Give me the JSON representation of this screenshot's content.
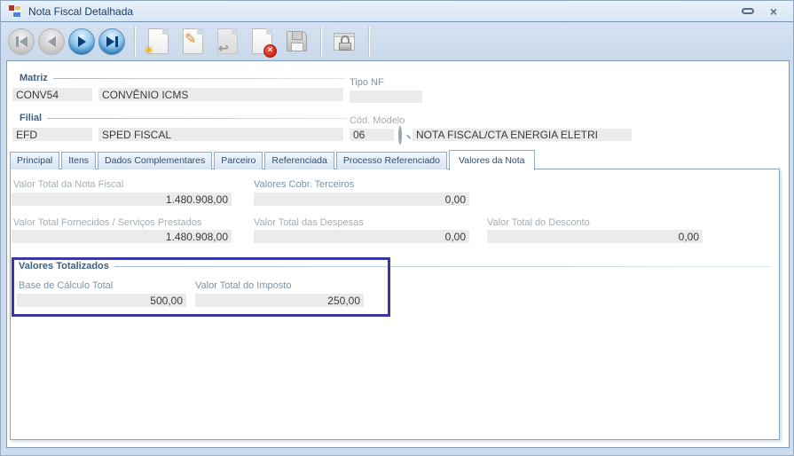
{
  "window": {
    "title": "Nota Fiscal Detalhada",
    "close_glyph": "×"
  },
  "toolbar": {
    "buttons": [
      {
        "icon": "first-record-icon",
        "enabled": false
      },
      {
        "icon": "previous-record-icon",
        "enabled": false
      },
      {
        "icon": "next-record-icon",
        "enabled": true
      },
      {
        "icon": "last-record-icon",
        "enabled": true
      },
      {
        "icon": "new-record-icon",
        "enabled": true,
        "glyph": "☀"
      },
      {
        "icon": "edit-record-icon",
        "enabled": true,
        "glyph": "✎"
      },
      {
        "icon": "undo-icon",
        "enabled": false,
        "glyph": "↩"
      },
      {
        "icon": "delete-record-icon",
        "enabled": true,
        "glyph": "×"
      },
      {
        "icon": "save-icon",
        "enabled": false
      },
      {
        "icon": "security-lock-icon",
        "enabled": true
      }
    ]
  },
  "header": {
    "matriz": {
      "label": "Matriz",
      "code": "CONV54",
      "name": "CONVÊNIO ICMS"
    },
    "filial": {
      "label": "Filial",
      "code": "EFD",
      "name": "SPED FISCAL"
    },
    "tipo_nf": {
      "label": "Tipo NF",
      "value": ""
    },
    "cod_modelo": {
      "label": "Cód. Modelo",
      "code": "06",
      "description": "NOTA FISCAL/CTA ENERGIA ELETRI"
    }
  },
  "tabs": {
    "active": "Valores da Nota",
    "items": [
      {
        "label": "Principal"
      },
      {
        "label": "Itens"
      },
      {
        "label": "Dados Complementares"
      },
      {
        "label": "Parceiro"
      },
      {
        "label": "Referenciada"
      },
      {
        "label": "Processo Referenciado"
      },
      {
        "label": "Valores da Nota"
      }
    ]
  },
  "fields": {
    "valor_total_nota": {
      "label": "Valor Total da Nota Fiscal",
      "value": "1.480.908,00"
    },
    "valores_cobr_terceiros": {
      "label": "Valores Cobr. Terceiros",
      "value": "0,00"
    },
    "valor_total_fornecidos": {
      "label": "Valor Total Fornecidos / Serviços Prestados",
      "value": "1.480.908,00"
    },
    "valor_total_despesas": {
      "label": "Valor Total das Despesas",
      "value": "0,00"
    },
    "valor_total_desconto": {
      "label": "Valor Total do Desconto",
      "value": "0,00"
    }
  },
  "valores_totalizados": {
    "label": "Valores Totalizados",
    "base_calculo_total": {
      "label": "Base de Cálculo Total",
      "value": "500,00"
    },
    "valor_total_imposto": {
      "label": "Valor Total do Imposto",
      "value": "250,00"
    }
  },
  "colors": {
    "highlight_box": "#3737A8",
    "field_bg": "#EBEBEB",
    "titlebar": "#DCE9F6",
    "toolbar": "#CFDEEE",
    "panel_border": "#8AA4C0"
  }
}
